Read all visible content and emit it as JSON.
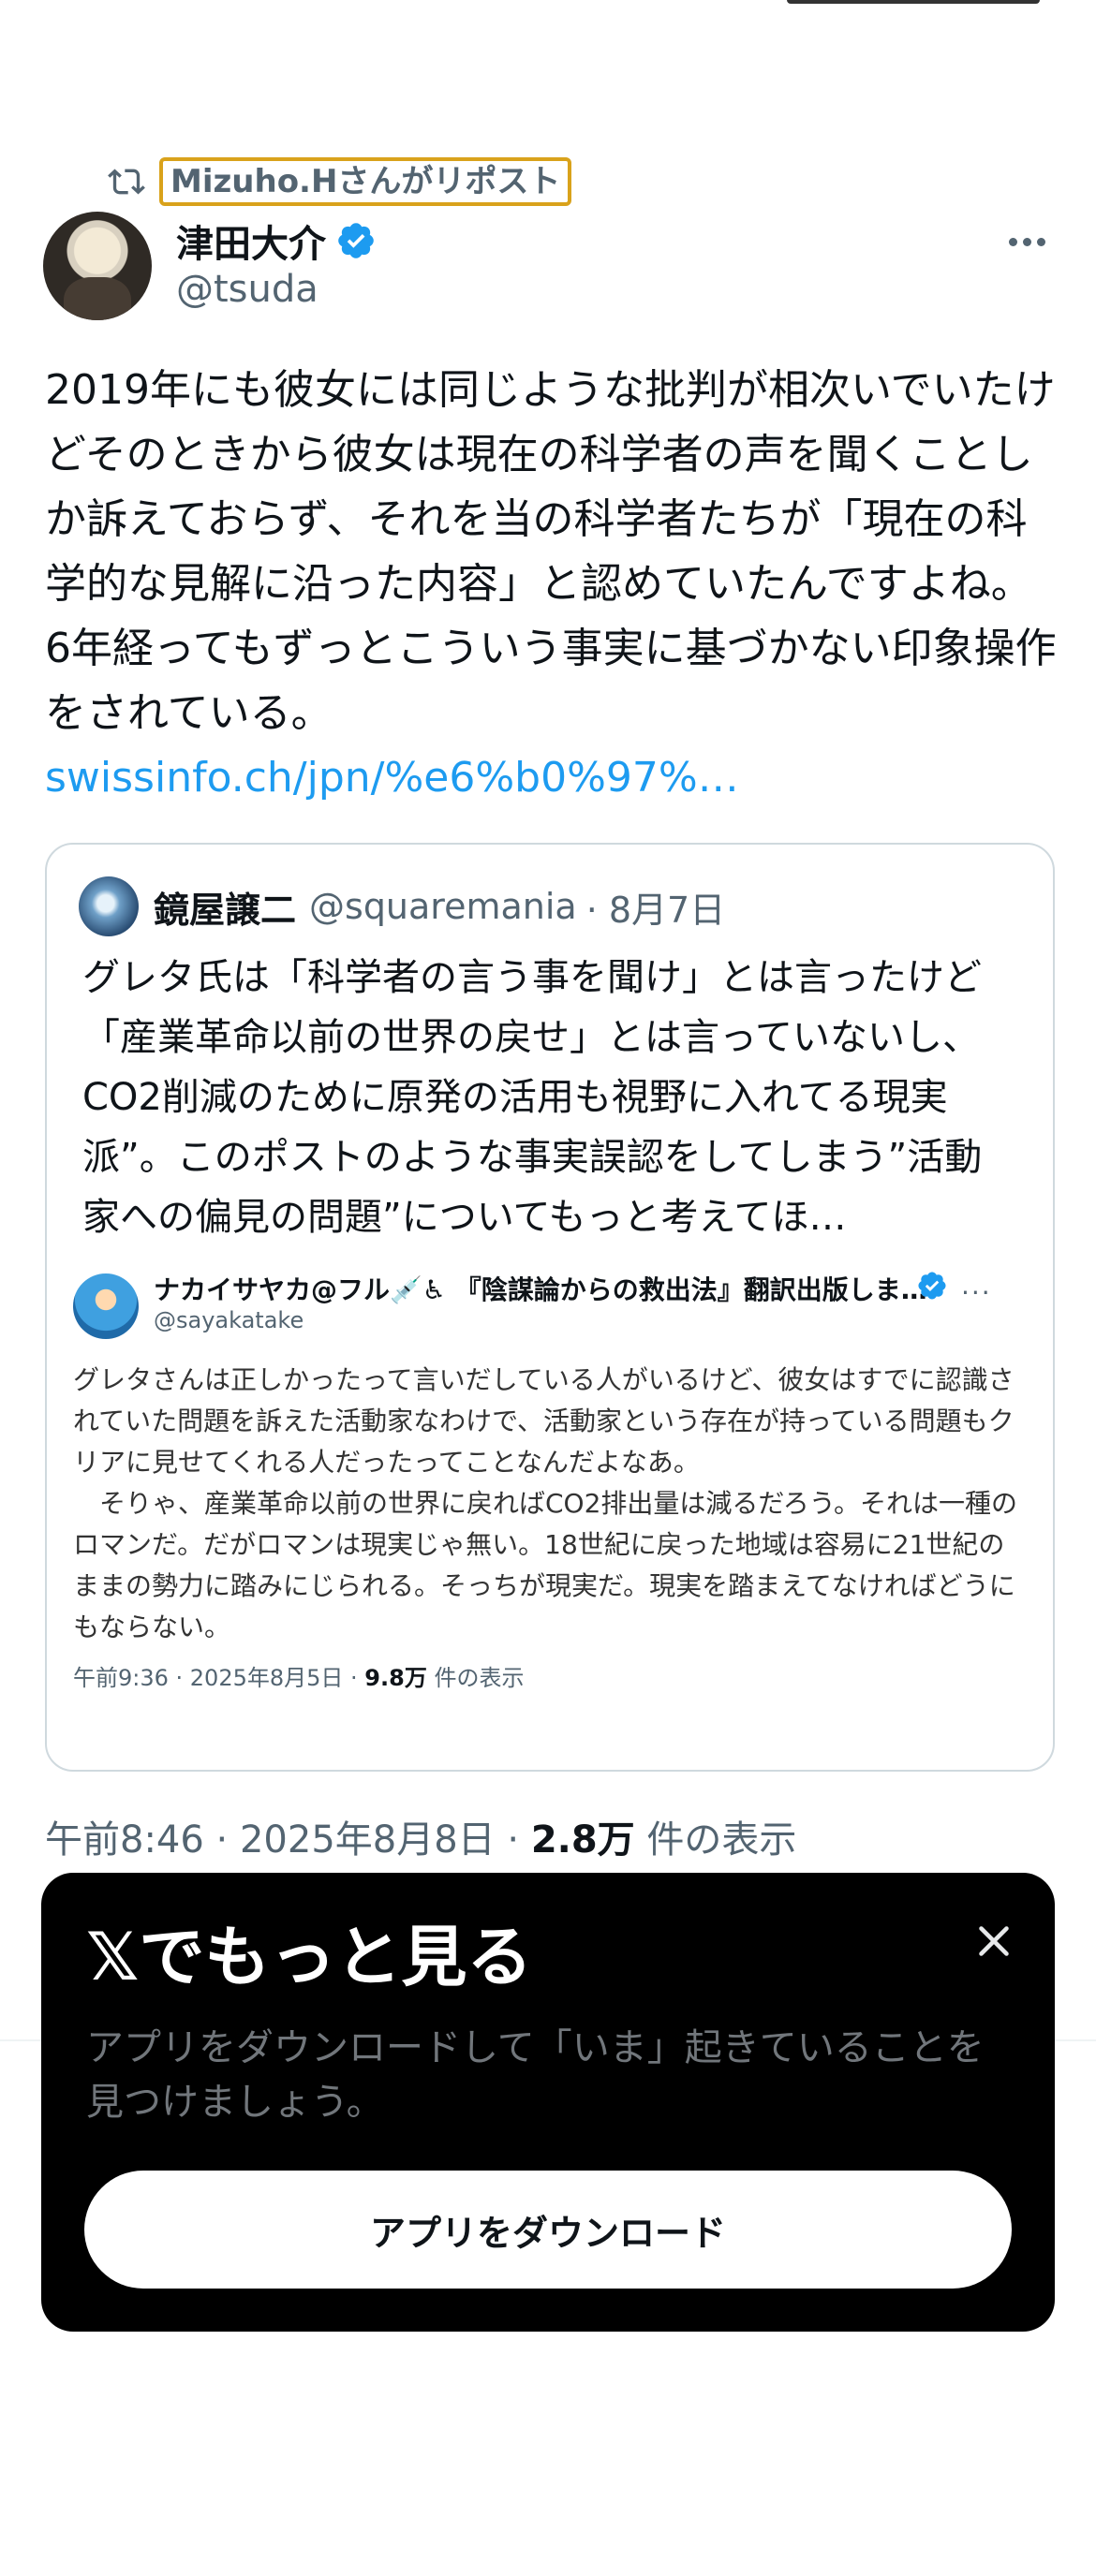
{
  "repost": {
    "label": "Mizuho.Hさんがリポスト",
    "icon": "repost-icon"
  },
  "author": {
    "display_name": "津田大介",
    "handle": "@tsuda",
    "verified": true
  },
  "tweet": {
    "text": "2019年にも彼女には同じような批判が相次いでいたけどそのときから彼女は現在の科学者の声を聞くことしか訴えておらず、それを当の科学者たちが「現在の科学的な見解に沿った内容」と認めていたんですよね。6年経ってもずっとこういう事実に基づかない印象操作をされている。",
    "link": "swissinfo.ch/jpn/%e6%b0%97%…"
  },
  "quote": {
    "display_name": "鏡屋譲二",
    "handle": "@squaremania",
    "date": "· 8月7日",
    "text": "グレタ氏は「科学者の言う事を聞け」とは言ったけど「産業革命以前の世界の戻せ」とは言っていないし、CO2削減のために原発の活用も視野に入れてる現実派”。このポストのような事実誤認をしてしまう”活動家への偏見の問題”についてもっと考えてほ…",
    "embedded": {
      "display_name": "ナカイサヤカ@フル💉♿ 『陰謀論からの救出法』翻訳出版しま…",
      "handle": "@sayakatake",
      "text": "グレタさんは正しかったって言いだしている人がいるけど、彼女はすでに認識されていた問題を訴えた活動家なわけで、活動家という存在が持っている問題もクリアに見せてくれる人だったってことなんだよなあ。\n　そりゃ、産業革命以前の世界に戻ればCO2排出量は減るだろう。それは一種のロマンだ。だがロマンは現実じゃ無い。18世紀に戻った地域は容易に21世紀のままの勢力に踏みにじられる。そっちが現実だ。現実を踏まえてなければどうにもならない。",
      "meta_prefix": "午前9:36 · 2025年8月5日 · ",
      "views": "9.8万",
      "views_suffix": " 件の表示",
      "more": "···"
    }
  },
  "meta": {
    "time": "午前8:46 · 2025年8月8日 · ",
    "views": "2.8万",
    "views_suffix": " 件の表示"
  },
  "sheet": {
    "title": "𝕏でもっと見る",
    "description": "アプリをダウンロードして「いま」起きていることを見つけましょう。",
    "button": "アプリをダウンロード"
  },
  "colors": {
    "accent": "#1d9bf0",
    "highlight_border": "#d9a21b",
    "sheet_bg": "#000000"
  }
}
